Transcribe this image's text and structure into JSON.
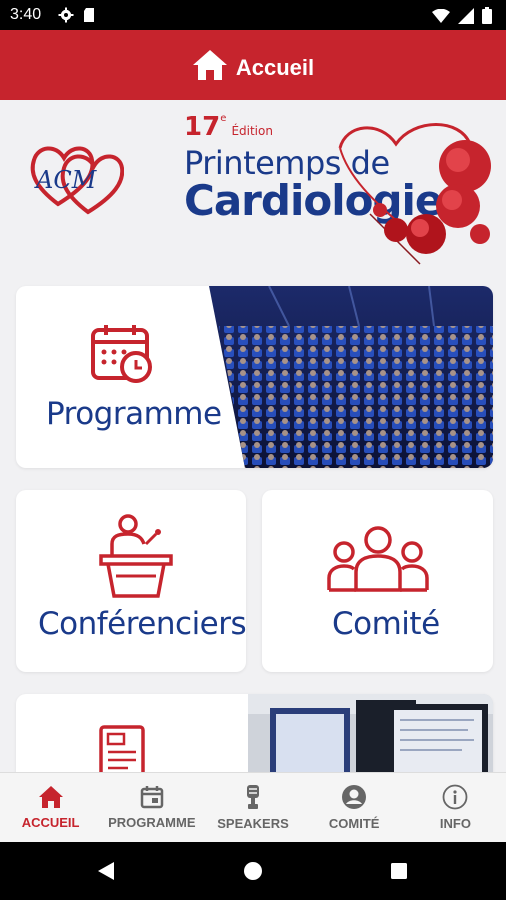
{
  "status_bar": {
    "time": "3:40"
  },
  "header": {
    "title": "Accueil",
    "icon": "home-icon"
  },
  "banner": {
    "logo_text": "ACM",
    "edition_number": "17",
    "edition_suffix": "e",
    "edition_word": "Édition",
    "title_line1": "Printemps de",
    "title_line2": "Cardiologie"
  },
  "cards": {
    "programme": {
      "label": "Programme",
      "icon": "calendar-clock-icon"
    },
    "speakers": {
      "label": "Conférenciers",
      "icon": "speaker-podium-icon"
    },
    "committee": {
      "label": "Comité",
      "icon": "group-icon"
    },
    "fourth": {
      "label": "",
      "icon": "document-icon"
    }
  },
  "bottom_nav": [
    {
      "label": "ACCUEIL",
      "icon": "home-icon",
      "active": true
    },
    {
      "label": "PROGRAMME",
      "icon": "calendar-icon",
      "active": false
    },
    {
      "label": "SPEAKERS",
      "icon": "microphone-icon",
      "active": false
    },
    {
      "label": "COMITÉ",
      "icon": "account-icon",
      "active": false
    },
    {
      "label": "INFO",
      "icon": "info-icon",
      "active": false
    }
  ],
  "colors": {
    "primary": "#c6242d",
    "navy": "#1a3a8a",
    "background": "#f1f1f3"
  }
}
